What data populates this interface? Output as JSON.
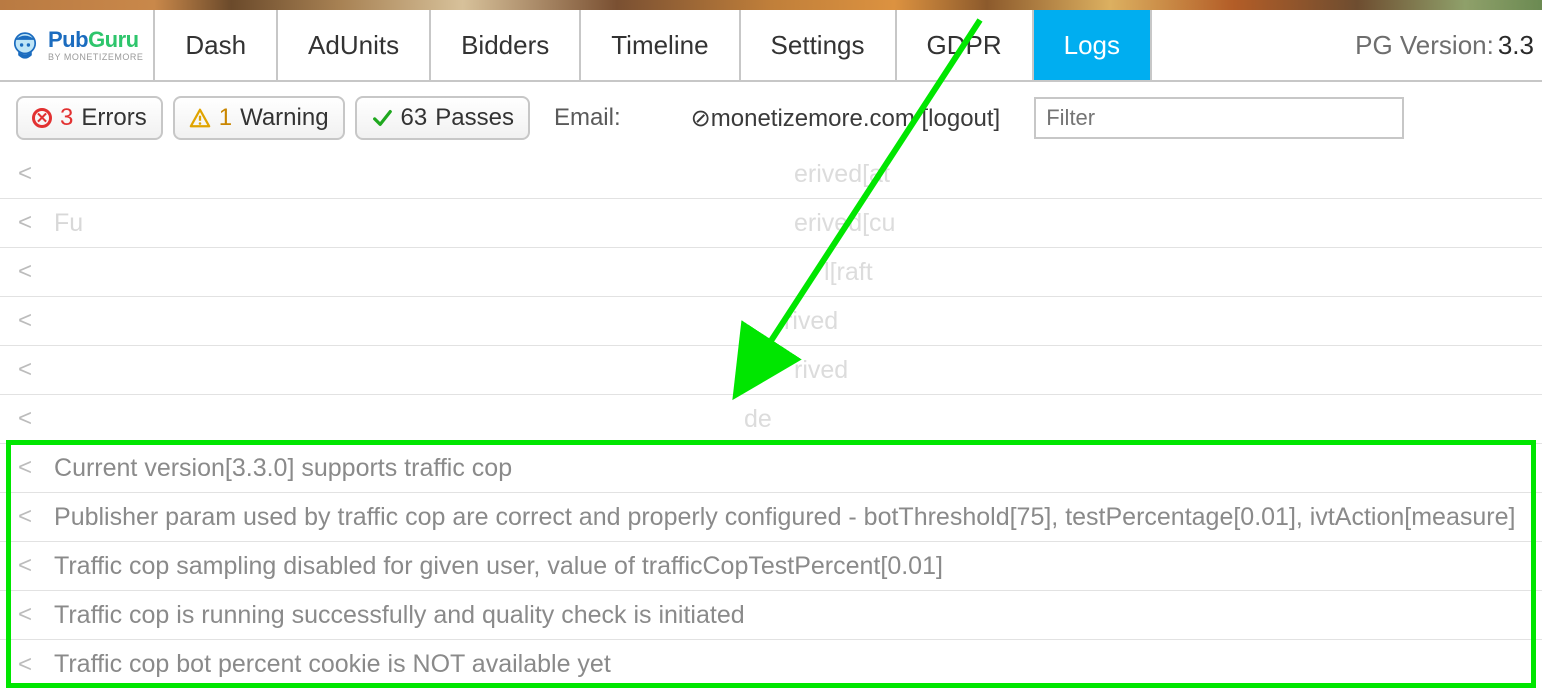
{
  "brand": {
    "name_prefix": "Pub",
    "name_suffix": "Guru",
    "sub": "by MONETIZEMORE"
  },
  "tabs": {
    "dash": "Dash",
    "adunits": "AdUnits",
    "bidders": "Bidders",
    "timeline": "Timeline",
    "settings": "Settings",
    "gdpr": "GDPR",
    "logs": "Logs"
  },
  "version": {
    "label": "PG Version: ",
    "value": "3.3"
  },
  "status": {
    "errors_count": "3",
    "errors_label": "Errors",
    "warnings_count": "1",
    "warnings_label": "Warning",
    "passes_count": "63",
    "passes_label": "Passes"
  },
  "email": {
    "label": "Email:",
    "domain": "⊘monetizemore.com",
    "logout": "[logout]"
  },
  "filter": {
    "placeholder": "Filter"
  },
  "logs": [
    "",
    "Fu",
    "",
    "",
    "",
    "",
    "",
    "Current version[3.3.0] supports traffic cop",
    "Publisher param used by traffic cop are correct and properly configured - botThreshold[75], testPercentage[0.01], ivtAction[measure]",
    "Traffic cop sampling disabled for given user, value of trafficCopTestPercent[0.01]",
    "Traffic cop is running successfully and quality check is initiated",
    "Traffic cop bot percent cookie is NOT available yet"
  ],
  "log_fragments": {
    "0": "erived[at",
    "1": "erived[cu",
    "2": "l[raft",
    "3": "rived",
    "4": "rived",
    "5": "de"
  }
}
